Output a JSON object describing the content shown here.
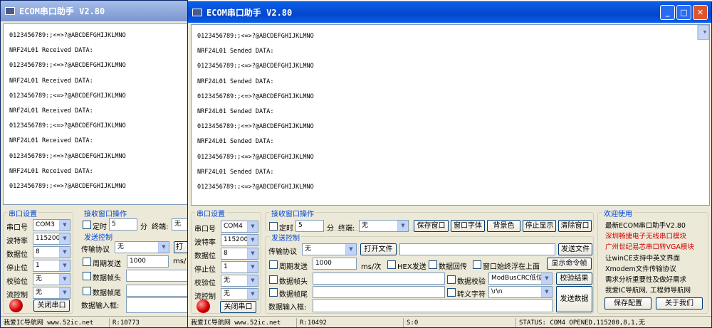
{
  "window_back": {
    "title": "ECOM串口助手  V2.80",
    "receive_lines": [
      "0123456789:;<=>?@ABCDEFGHIJKLMNO",
      "NRF24L01 Received DATA:",
      "0123456789:;<=>?@ABCDEFGHIJKLMNO",
      "NRF24L01 Received DATA:",
      "0123456789:;<=>?@ABCDEFGHIJKLMNO",
      "NRF24L01 Received DATA:",
      "0123456789:;<=>?@ABCDEFGHIJKLMNO",
      "NRF24L01 Received DATA:",
      "0123456789:;<=>?@ABCDEFGHIJKLMNO",
      "NRF24L01 Received DATA:",
      "0123456789:;<=>?@ABCDEFGHIJKLMNO"
    ],
    "port": {
      "group": "串口设置",
      "port_label": "串口号",
      "port_value": "COM3",
      "baud_label": "波特率",
      "baud_value": "115200",
      "data_label": "数据位",
      "data_value": "8",
      "stop_label": "停止位",
      "stop_value": "1",
      "parity_label": "校验位",
      "parity_value": "无",
      "flow_label": "流控制",
      "flow_value": "无",
      "close_btn": "关闭串口"
    },
    "recv": {
      "group": "接收窗口操作",
      "timer_label": "定时",
      "timer_value": "5",
      "unit": "分",
      "terminal_label": "终端:",
      "terminal_value": "无"
    },
    "send": {
      "group": "发送控制",
      "protocol_label": "传输协议",
      "protocol_value": "无",
      "open_btn": "打",
      "periodic_label": "周期发送",
      "periodic_value": "1000",
      "periodic_unit": "ms/",
      "header_label": "数据帧头",
      "tail_label": "数据帧尾",
      "input_label": "数据输入框:"
    },
    "status": {
      "site": "我爱IC导航网 www.52ic.net",
      "rx": "R:10773"
    }
  },
  "window_front": {
    "title": "ECOM串口助手  V2.80",
    "controls": {
      "minimize": "_",
      "maximize": "□",
      "close": "✕"
    },
    "receive_lines": [
      "0123456789:;<=>?@ABCDEFGHIJKLMNO",
      "NRF24L01 Sended DATA:",
      "0123456789:;<=>?@ABCDEFGHIJKLMNO",
      "NRF24L01 Sended DATA:",
      "0123456789:;<=>?@ABCDEFGHIJKLMNO",
      "NRF24L01 Sended DATA:",
      "0123456789:;<=>?@ABCDEFGHIJKLMNO",
      "NRF24L01 Sended DATA:",
      "0123456789:;<=>?@ABCDEFGHIJKLMNO",
      "NRF24L01 Sended DATA:",
      "0123456789:;<=>?@ABCDEFGHIJKLMNO"
    ],
    "port": {
      "group": "串口设置",
      "port_label": "串口号",
      "port_value": "COM4",
      "baud_label": "波特率",
      "baud_value": "115200",
      "data_label": "数据位",
      "data_value": "8",
      "stop_label": "停止位",
      "stop_value": "1",
      "parity_label": "校验位",
      "parity_value": "无",
      "flow_label": "流控制",
      "flow_value": "无",
      "close_btn": "关闭串口"
    },
    "recv": {
      "group": "接收窗口操作",
      "timer_label": "定时",
      "timer_value": "5",
      "unit": "分",
      "terminal_label": "终端:",
      "terminal_value": "无",
      "save_btn": "保存窗口",
      "font_btn": "窗口字体",
      "bg_btn": "背景色",
      "pause_btn": "停止显示",
      "clear_btn": "清除窗口"
    },
    "send": {
      "group": "发送控制",
      "protocol_label": "传输协议",
      "protocol_value": "无",
      "open_btn": "打开文件",
      "send_file_btn": "发送文件",
      "periodic_label": "周期发送",
      "periodic_value": "1000",
      "periodic_unit": "ms/次",
      "hex_label": "HEX发送",
      "echo_label": "数据回传",
      "topmost_label": "窗口始终浮在上面",
      "show_cmd_btn": "显示命令帧",
      "header_label": "数据帧头",
      "checksum_label": "数据校验",
      "checksum_value": "ModBusCRC低位在",
      "checksum_btn": "校验结果",
      "tail_label": "数据帧尾",
      "escape_label": "转义字符",
      "escape_value": "\\r\\n",
      "send_btn": "发送数据",
      "input_label": "数据输入框:"
    },
    "welcome": {
      "group": "欢迎使用",
      "lines": [
        {
          "text": "最新ECOM串口助手V2.80",
          "red": false
        },
        {
          "text": "深圳畅捷电子无线串口模块",
          "red": true
        },
        {
          "text": "广州世纪易芯串口转VGA模块",
          "red": true
        },
        {
          "text": "让winCE支持中英文界面",
          "red": false
        },
        {
          "text": "Xmodem文件传输协议",
          "red": false
        },
        {
          "text": "需求分析重要性及做好需求",
          "red": false
        },
        {
          "text": "我爱IC导航网, 工程师导航网",
          "red": false
        }
      ],
      "save_cfg_btn": "保存配置",
      "about_btn": "关于我们"
    },
    "status": {
      "site": "我爱IC导航网 www.52ic.net",
      "rx": "R:10492",
      "tx": "S:0",
      "state": "STATUS: COM4 OPENED,115200,8,1,无"
    }
  }
}
